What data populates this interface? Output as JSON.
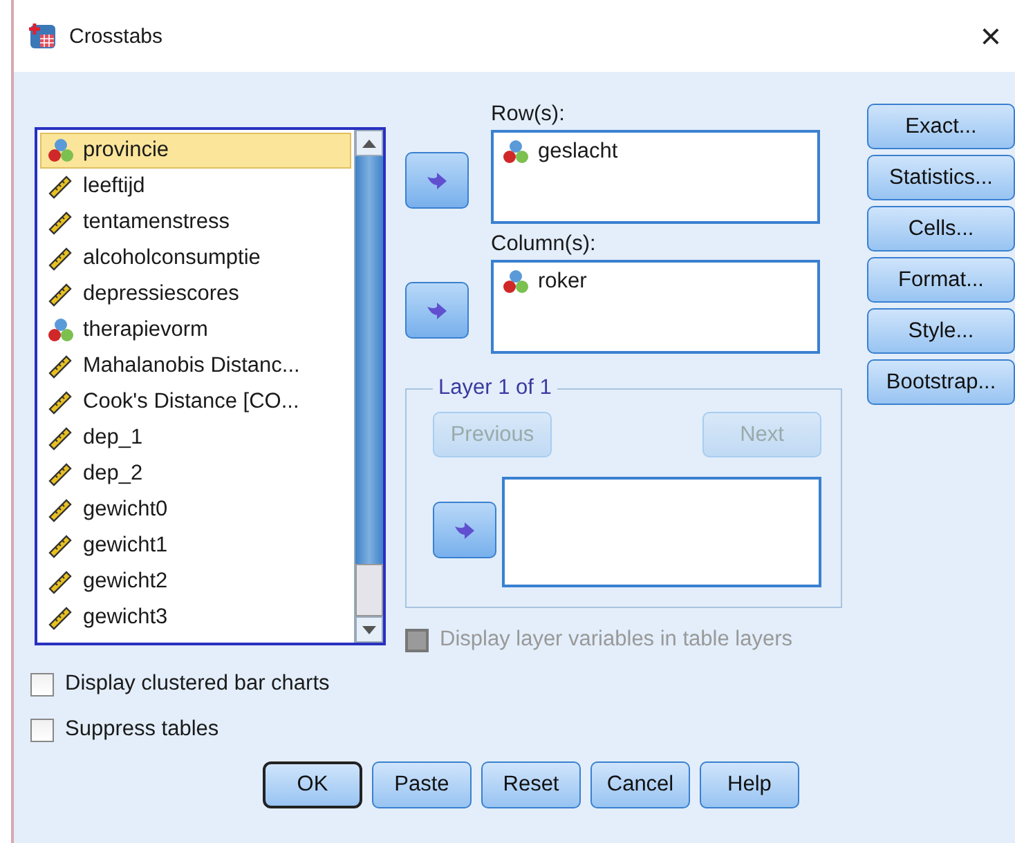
{
  "window": {
    "title": "Crosstabs",
    "close": "×"
  },
  "variables": [
    {
      "name": "provincie",
      "kind": "nominal",
      "selected": true
    },
    {
      "name": "leeftijd",
      "kind": "scale",
      "selected": false
    },
    {
      "name": "tentamenstress",
      "kind": "scale",
      "selected": false
    },
    {
      "name": "alcoholconsumptie",
      "kind": "scale",
      "selected": false
    },
    {
      "name": "depressiescores",
      "kind": "scale",
      "selected": false
    },
    {
      "name": "therapievorm",
      "kind": "nominal",
      "selected": false
    },
    {
      "name": "Mahalanobis Distanc...",
      "kind": "scale",
      "selected": false
    },
    {
      "name": "Cook's Distance [CO...",
      "kind": "scale",
      "selected": false
    },
    {
      "name": "dep_1",
      "kind": "scale",
      "selected": false
    },
    {
      "name": "dep_2",
      "kind": "scale",
      "selected": false
    },
    {
      "name": "gewicht0",
      "kind": "scale",
      "selected": false
    },
    {
      "name": "gewicht1",
      "kind": "scale",
      "selected": false
    },
    {
      "name": "gewicht2",
      "kind": "scale",
      "selected": false
    },
    {
      "name": "gewicht3",
      "kind": "scale",
      "selected": false
    }
  ],
  "rows": {
    "label": "Row(s):",
    "items": [
      {
        "name": "geslacht",
        "kind": "nominal"
      }
    ]
  },
  "columns": {
    "label": "Column(s):",
    "items": [
      {
        "name": "roker",
        "kind": "nominal"
      }
    ]
  },
  "side_buttons": [
    "Exact...",
    "Statistics...",
    "Cells...",
    "Format...",
    "Style...",
    "Bootstrap..."
  ],
  "layer": {
    "title": "Layer 1 of 1",
    "previous": {
      "label": "Previous",
      "disabled": true
    },
    "next": {
      "label": "Next",
      "disabled": true
    }
  },
  "layer_option": {
    "label": "Display layer variables in table layers",
    "checked": false,
    "disabled": true
  },
  "options": [
    {
      "label": "Display clustered bar charts",
      "checked": false,
      "disabled": false
    },
    {
      "label": "Suppress tables",
      "checked": false,
      "disabled": false
    }
  ],
  "buttons": [
    {
      "label": "OK",
      "default": true
    },
    {
      "label": "Paste",
      "default": false
    },
    {
      "label": "Reset",
      "default": false
    },
    {
      "label": "Cancel",
      "default": false
    },
    {
      "label": "Help",
      "default": false
    }
  ]
}
